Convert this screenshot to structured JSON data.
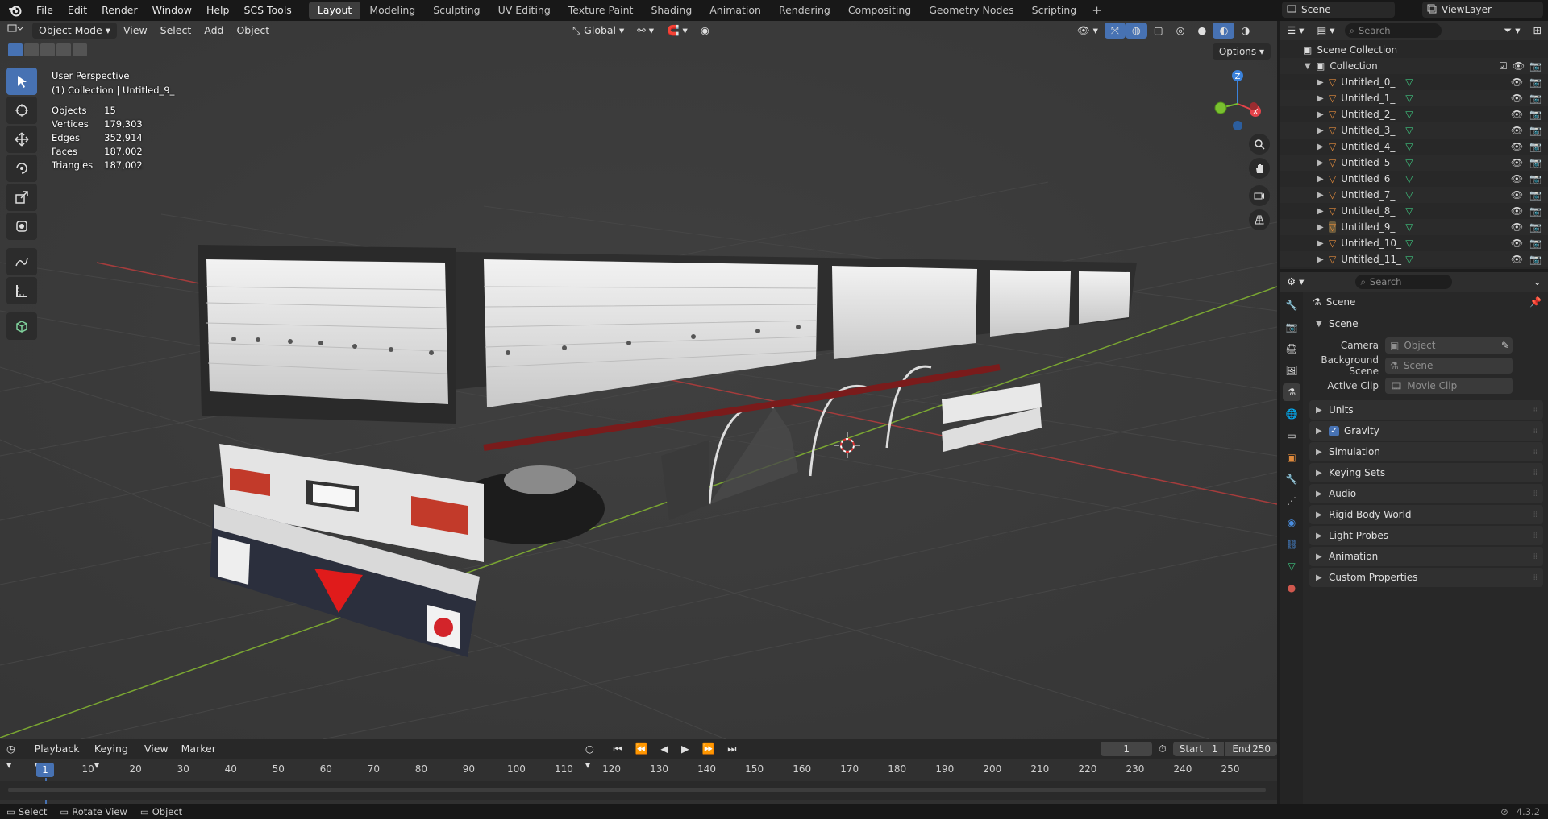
{
  "menubar": {
    "items": [
      "File",
      "Edit",
      "Render",
      "Window",
      "Help",
      "SCS Tools"
    ],
    "workspaces": [
      "Layout",
      "Modeling",
      "Sculpting",
      "UV Editing",
      "Texture Paint",
      "Shading",
      "Animation",
      "Rendering",
      "Compositing",
      "Geometry Nodes",
      "Scripting"
    ],
    "active_workspace": "Layout",
    "add_workspace": "+",
    "scene": "Scene",
    "view_layer": "ViewLayer"
  },
  "viewport": {
    "mode": "Object Mode",
    "menus": [
      "View",
      "Select",
      "Add",
      "Object"
    ],
    "transform_orientation": "Global",
    "options_label": "Options",
    "overlay_title": "User Perspective",
    "overlay_subtitle": "(1) Collection | Untitled_9_",
    "stats": [
      {
        "label": "Objects",
        "value": "15"
      },
      {
        "label": "Vertices",
        "value": "179,303"
      },
      {
        "label": "Edges",
        "value": "352,914"
      },
      {
        "label": "Faces",
        "value": "187,002"
      },
      {
        "label": "Triangles",
        "value": "187,002"
      }
    ],
    "gizmo_axes": {
      "x": "X",
      "y": "Y",
      "z": "Z"
    }
  },
  "timeline": {
    "menus": [
      "Playback",
      "Keying",
      "View",
      "Marker"
    ],
    "current_frame": "1",
    "start_label": "Start",
    "start": "1",
    "end_label": "End",
    "end": "250",
    "ticks": [
      "1",
      "10",
      "20",
      "30",
      "40",
      "50",
      "60",
      "70",
      "80",
      "90",
      "100",
      "110",
      "120",
      "130",
      "140",
      "150",
      "160",
      "170",
      "180",
      "190",
      "200",
      "210",
      "220",
      "230",
      "240",
      "250"
    ]
  },
  "statusbar": {
    "select": "Select",
    "rotate": "Rotate View",
    "object": "Object",
    "version": "4.3.2"
  },
  "outliner": {
    "search_placeholder": "Search",
    "scene_collection": "Scene Collection",
    "collection": "Collection",
    "objects": [
      "Untitled_0_",
      "Untitled_1_",
      "Untitled_2_",
      "Untitled_3_",
      "Untitled_4_",
      "Untitled_5_",
      "Untitled_6_",
      "Untitled_7_",
      "Untitled_8_",
      "Untitled_9_",
      "Untitled_10_",
      "Untitled_11_"
    ],
    "active_object": "Untitled_9_"
  },
  "properties": {
    "search_placeholder": "Search",
    "context": "Scene",
    "section": "Scene",
    "camera_label": "Camera",
    "camera_placeholder": "Object",
    "bg_scene_label": "Background Scene",
    "bg_scene_placeholder": "Scene",
    "clip_label": "Active Clip",
    "clip_placeholder": "Movie Clip",
    "panels": [
      "Units",
      "Gravity",
      "Simulation",
      "Keying Sets",
      "Audio",
      "Rigid Body World",
      "Light Probes",
      "Animation",
      "Custom Properties"
    ],
    "gravity_checked": true
  },
  "colors": {
    "accent": "#4772b3",
    "object_orange": "#e08a3c",
    "mesh_green": "#3ec37e",
    "axis_x": "#e5434a",
    "axis_y": "#79c02f",
    "axis_z": "#3b82db"
  }
}
